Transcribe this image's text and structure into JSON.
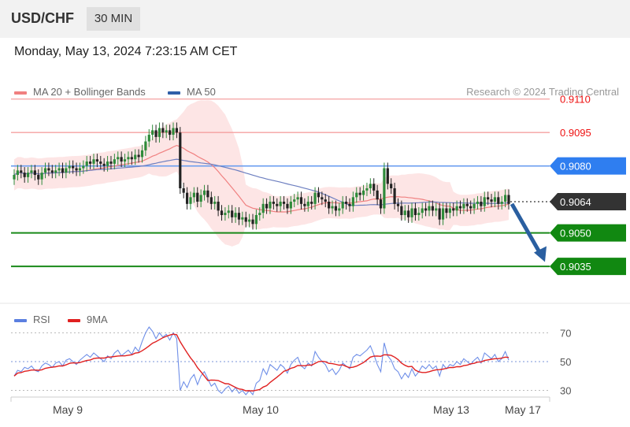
{
  "header": {
    "symbol": "USD/CHF",
    "interval": "30 MIN"
  },
  "datetime": "Monday, May 13, 2024 7:23:15 AM CET",
  "legend": {
    "ma20": {
      "label": "MA 20 + Bollinger Bands",
      "color": "#f08080"
    },
    "ma50": {
      "label": "MA 50",
      "color": "#2f5fa8"
    }
  },
  "credit": "Research © 2024 Trading Central",
  "rsi_legend": {
    "rsi": {
      "label": "RSI",
      "color": "#5b7fe0"
    },
    "ma9": {
      "label": "9MA",
      "color": "#e02020"
    }
  },
  "chart_data": [
    {
      "type": "candlestick",
      "ylim": [
        0.90195,
        0.91205
      ],
      "current_price": "0.9064",
      "levels": [
        {
          "label": "0.9110",
          "value": 0.911,
          "kind": "resistance"
        },
        {
          "label": "0.9095",
          "value": 0.9095,
          "kind": "resistance"
        },
        {
          "label": "0.9080",
          "value": 0.908,
          "kind": "pivot"
        },
        {
          "label": "0.9064",
          "value": 0.9064,
          "kind": "last"
        },
        {
          "label": "0.9050",
          "value": 0.905,
          "kind": "support"
        },
        {
          "label": "0.9035",
          "value": 0.9035,
          "kind": "support"
        }
      ],
      "projection": {
        "direction": "down",
        "from": 0.9063,
        "to": 0.9037
      },
      "closes": [
        0.9076,
        0.9078,
        0.9077,
        0.9075,
        0.9077,
        0.9078,
        0.9076,
        0.9074,
        0.9077,
        0.9079,
        0.9078,
        0.9077,
        0.9078,
        0.9079,
        0.9077,
        0.9079,
        0.908,
        0.9079,
        0.9078,
        0.9079,
        0.908,
        0.9082,
        0.9081,
        0.9083,
        0.9082,
        0.9081,
        0.908,
        0.9082,
        0.9081,
        0.9083,
        0.9084,
        0.9082,
        0.9083,
        0.9084,
        0.9083,
        0.9085,
        0.9084,
        0.9087,
        0.9091,
        0.9094,
        0.9096,
        0.9093,
        0.9097,
        0.9095,
        0.9096,
        0.9094,
        0.9097,
        0.9095,
        0.907,
        0.9068,
        0.9063,
        0.9066,
        0.9068,
        0.9064,
        0.9067,
        0.9069,
        0.9066,
        0.9063,
        0.9064,
        0.906,
        0.9058,
        0.9059,
        0.906,
        0.9057,
        0.9059,
        0.9056,
        0.9057,
        0.9055,
        0.9056,
        0.9054,
        0.9058,
        0.9059,
        0.9063,
        0.9061,
        0.9064,
        0.9063,
        0.9062,
        0.9064,
        0.9063,
        0.9061,
        0.9064,
        0.9065,
        0.9066,
        0.9063,
        0.9062,
        0.9064,
        0.9063,
        0.9068,
        0.9066,
        0.9065,
        0.9064,
        0.9061,
        0.9062,
        0.906,
        0.9061,
        0.9064,
        0.9063,
        0.9062,
        0.9066,
        0.9068,
        0.9067,
        0.9069,
        0.907,
        0.9072,
        0.9069,
        0.9065,
        0.9061,
        0.9079,
        0.9072,
        0.907,
        0.9063,
        0.9062,
        0.9058,
        0.906,
        0.9057,
        0.9061,
        0.9058,
        0.9059,
        0.9061,
        0.906,
        0.9062,
        0.906,
        0.9061,
        0.9056,
        0.9061,
        0.9059,
        0.9061,
        0.906,
        0.9062,
        0.9061,
        0.9063,
        0.9062,
        0.9061,
        0.9063,
        0.9064,
        0.9062,
        0.9066,
        0.9065,
        0.9064,
        0.9066,
        0.9063,
        0.9064,
        0.9067,
        0.9063
      ],
      "x_ticks": [
        "May 9",
        "May 10",
        "May 13",
        "May 17"
      ]
    },
    {
      "type": "line",
      "name": "RSI",
      "ylim": [
        21,
        79
      ],
      "y_ticks": [
        70,
        50,
        30
      ],
      "series": [
        {
          "name": "RSI",
          "values": [
            40,
            44,
            43,
            46,
            45,
            47,
            44,
            43,
            47,
            49,
            48,
            46,
            49,
            50,
            47,
            51,
            52,
            50,
            48,
            51,
            53,
            55,
            53,
            56,
            54,
            52,
            50,
            54,
            52,
            56,
            58,
            54,
            56,
            58,
            55,
            60,
            57,
            64,
            70,
            74,
            71,
            66,
            70,
            67,
            69,
            65,
            70,
            66,
            30,
            36,
            32,
            38,
            41,
            34,
            40,
            43,
            38,
            33,
            35,
            30,
            28,
            31,
            33,
            29,
            32,
            28,
            30,
            27,
            30,
            27,
            35,
            37,
            45,
            41,
            48,
            46,
            44,
            48,
            46,
            42,
            48,
            51,
            53,
            47,
            45,
            49,
            47,
            57,
            53,
            50,
            48,
            43,
            45,
            41,
            44,
            49,
            47,
            45,
            53,
            55,
            54,
            56,
            58,
            61,
            55,
            48,
            43,
            63,
            54,
            51,
            45,
            43,
            38,
            42,
            39,
            45,
            40,
            43,
            47,
            45,
            48,
            45,
            47,
            40,
            48,
            45,
            48,
            47,
            50,
            48,
            52,
            50,
            48,
            51,
            53,
            49,
            56,
            54,
            52,
            55,
            50,
            52,
            57,
            51
          ]
        },
        {
          "name": "9MA"
        }
      ]
    }
  ]
}
